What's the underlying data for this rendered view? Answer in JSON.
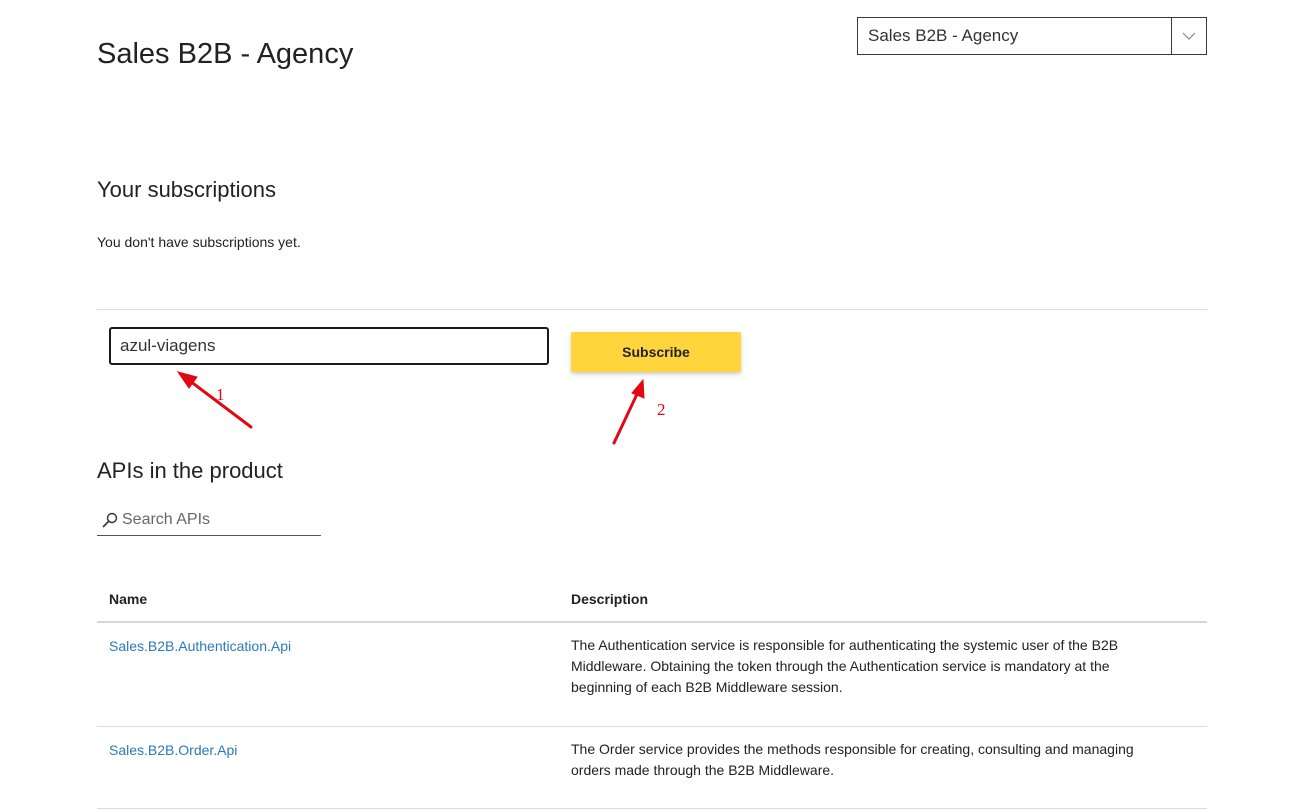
{
  "header": {
    "title": "Sales B2B - Agency",
    "product_select": {
      "value": "Sales B2B - Agency",
      "icon": "chevron-down-icon"
    }
  },
  "subscriptions": {
    "heading": "Your subscriptions",
    "empty_message": "You don't have subscriptions yet.",
    "name_input_value": "azul-viagens",
    "subscribe_label": "Subscribe"
  },
  "annotations": {
    "step1": "1",
    "step2": "2",
    "color": "#e30613"
  },
  "apis": {
    "heading": "APIs in the product",
    "search_placeholder": "Search APIs",
    "columns": [
      "Name",
      "Description"
    ],
    "rows": [
      {
        "name": "Sales.B2B.Authentication.Api",
        "description": "The Authentication service is responsible for authenticating the systemic user of the B2B Middleware. Obtaining the token through the Authentication service is mandatory at the beginning of each B2B Middleware session."
      },
      {
        "name": "Sales.B2B.Order.Api",
        "description": "The Order service provides the methods responsible for creating, consulting and managing orders made through the B2B Middleware."
      }
    ]
  },
  "colors": {
    "accent_button": "#ffd53b",
    "link": "#2a7ab8"
  }
}
